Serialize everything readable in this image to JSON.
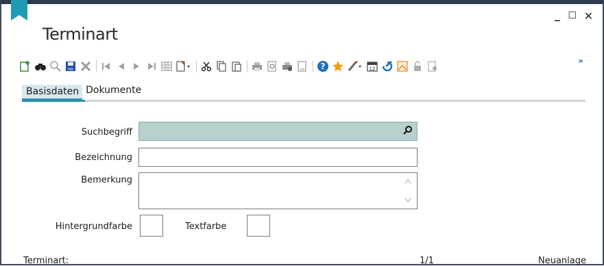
{
  "window": {
    "title": "Terminart",
    "controls": {
      "minimize": "_",
      "maximize": "☐",
      "close": "✕"
    }
  },
  "toolbar": {
    "icons": [
      "new-record-icon",
      "binoculars-icon",
      "magnifier-icon",
      "save-icon",
      "delete-icon",
      "first-record-icon",
      "previous-record-icon",
      "next-record-icon",
      "last-record-icon",
      "table-view-icon",
      "report-dropdown-icon",
      "cut-icon",
      "copy-icon",
      "paste-icon",
      "print-icon",
      "print-preview-icon",
      "print-setup-icon",
      "page-preview-icon",
      "help-icon",
      "favorite-star-icon",
      "paint-brush-icon",
      "calendar-icon",
      "edit-check-icon",
      "chart-icon",
      "lock-icon",
      "settings-document-icon"
    ],
    "more": "»"
  },
  "tabs": [
    {
      "label": "Basisdaten",
      "active": true
    },
    {
      "label": "Dokumente",
      "active": false
    }
  ],
  "form": {
    "suchbegriff": {
      "label": "Suchbegriff",
      "value": ""
    },
    "bezeichnung": {
      "label": "Bezeichnung",
      "value": ""
    },
    "bemerkung": {
      "label": "Bemerkung",
      "value": ""
    },
    "hintergrundfarbe": {
      "label": "Hintergrundfarbe"
    },
    "textfarbe": {
      "label": "Textfarbe"
    }
  },
  "statusbar": {
    "left": "Terminart:",
    "position": "1/1",
    "mode": "Neuanlage"
  },
  "colors": {
    "accent": "#2d8fb0",
    "search_field_bg": "#b6d1ce",
    "title_bar": "#2e3b4d",
    "bookmark": "#1e9bb5"
  }
}
